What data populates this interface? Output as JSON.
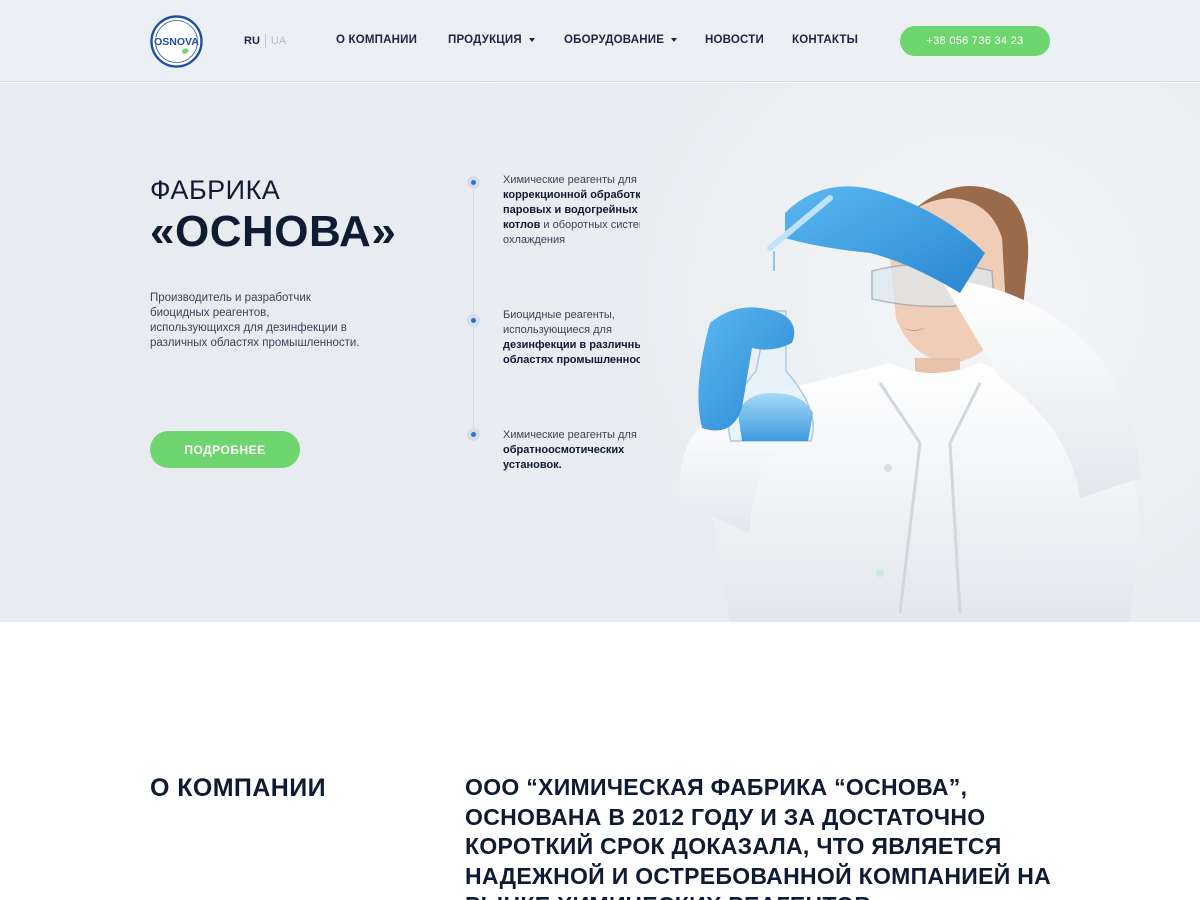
{
  "header": {
    "logo_text": "OSNOVA",
    "lang_active": "RU",
    "lang_inactive": "UA",
    "nav": [
      {
        "label": "О КОМПАНИИ",
        "dropdown": false
      },
      {
        "label": "ПРОДУКЦИЯ",
        "dropdown": true
      },
      {
        "label": "ОБОРУДОВАНИЕ",
        "dropdown": true
      },
      {
        "label": "НОВОСТИ",
        "dropdown": false
      },
      {
        "label": "КОНТАКТЫ",
        "dropdown": false
      }
    ],
    "phone": "+38 056 736 34 23"
  },
  "hero": {
    "subtitle": "ФАБРИКА",
    "title": "«ОСНОВА»",
    "description": "Производитель и разработчик биоцидных реагентов, использующихся для дезинфекции в различных областях промышленности.",
    "button": "ПОДРОБНЕЕ",
    "features": [
      {
        "pre": "Химические реагенты для ",
        "bold": "коррекционной обработки паровых и водогрейных котлов",
        "post": " и оборотных систем охлаждения"
      },
      {
        "pre": "Биоцидные реагенты, использующиеся для ",
        "bold": "дезинфекции в различных областях промышленности .",
        "post": ""
      },
      {
        "pre": "Химические реагенты для ",
        "bold": "обратноосмотических установок.",
        "post": ""
      }
    ]
  },
  "about": {
    "heading": "О КОМПАНИИ",
    "text": "ООО “ХИМИЧЕСКАЯ ФАБРИКА “ОСНОВА”, ОСНОВАНА В 2012 ГОДУ И ЗА ДОСТАТОЧНО КОРОТКИЙ СРОК ДОКАЗАЛА, ЧТО ЯВЛЯЕТСЯ НАДЕЖНОЙ И ОСТРЕБОВАННОЙ КОМПАНИЕЙ НА РЫНКЕ ХИМИЧЕСКИХ РЕАГЕНТОВ"
  },
  "colors": {
    "accent_green": "#6ed56f",
    "dark_navy": "#0f1a33",
    "logo_blue": "#1e4fa8",
    "dot_blue": "#2a74d8"
  }
}
